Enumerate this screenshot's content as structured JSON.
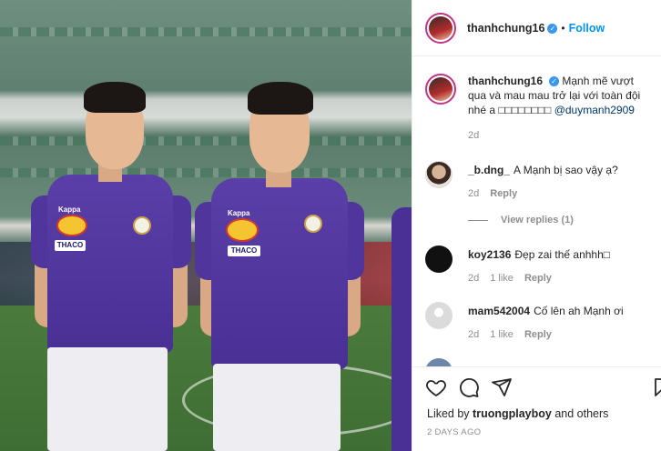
{
  "post": {
    "author": "thanhchung16",
    "follow_label": "Follow",
    "separator": "•",
    "verified_mark": "✓",
    "caption_text": "Mạnh mẽ vượt qua và mau mau trở lại với toàn đội nhé a □□□□□□□□",
    "caption_mention": "@duymanh2909",
    "caption_time": "2d"
  },
  "photo": {
    "sponsor_left": "THACO",
    "sponsor_right": "THACO",
    "brand_left": "Kappa",
    "brand_right": "Kappa"
  },
  "comments": [
    {
      "user": "_b.dng_",
      "text": "A Mạnh bị sao vậy ạ?",
      "time": "2d",
      "likes": "",
      "reply": "Reply"
    },
    {
      "user": "koy2136",
      "text": "Đẹp zai thế anhhh□",
      "time": "2d",
      "likes": "1 like",
      "reply": "Reply"
    },
    {
      "user": "mam542004",
      "text": "Cố lên ah Mạnh ơi",
      "time": "2d",
      "likes": "1 like",
      "reply": "Reply"
    }
  ],
  "view_replies": "View replies (1)",
  "liked_by": {
    "prefix": "Liked by",
    "user": "truongplayboy",
    "suffix": "and others"
  },
  "posted_ago": "2 DAYS AGO",
  "icons": {
    "heart": "heart-icon",
    "comment": "comment-icon",
    "share": "share-icon",
    "save": "bookmark-icon"
  },
  "colors": {
    "link": "#0095f6",
    "verified": "#3897f0",
    "muted": "#8e8e8e",
    "jersey": "#4a2f95"
  }
}
